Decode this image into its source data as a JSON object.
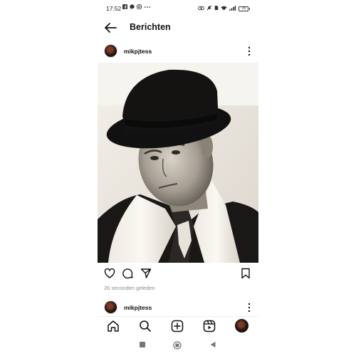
{
  "status_bar": {
    "time": "17:52",
    "notification_icons": [
      "facebook-icon",
      "messenger-icon",
      "instagram-icon",
      "more-dots-icon"
    ],
    "battery": "78"
  },
  "header": {
    "title": "Berichten"
  },
  "post": {
    "username": "mikpjtess",
    "time_ago": "26 seconden geleden",
    "photo_icon": "man-in-top-hat-photo"
  },
  "next_post": {
    "username": "mikpjtess"
  },
  "bottom_nav": {
    "items": [
      "home-icon",
      "search-icon",
      "create-icon",
      "reels-icon",
      "profile-avatar"
    ]
  },
  "system_nav": {
    "items": [
      "recents-button",
      "home-button",
      "back-button"
    ]
  }
}
